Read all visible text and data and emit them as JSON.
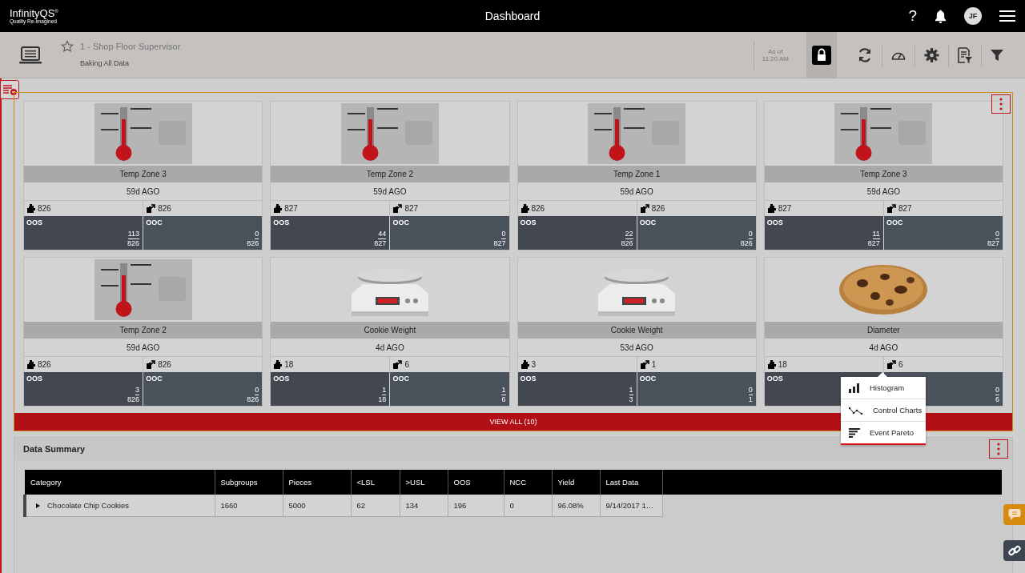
{
  "header": {
    "logo": "InfinityQS",
    "logo_mark": "®",
    "tagline": "Quality Re-imagined",
    "title": "Dashboard",
    "help": "?",
    "avatar": "JF"
  },
  "toolbar": {
    "title": "1 - Shop Floor Supervisor",
    "favorite": false,
    "subtitle": "Baking All Data",
    "as_of": "As of",
    "time": "11:20 AM",
    "locked": true
  },
  "tiles": [
    {
      "kind": "temperature",
      "name": "Temp Zone 3",
      "age": "59d AGO",
      "count_a": "826",
      "count_b": "826",
      "oos_label": "OOS",
      "oos_num": "113",
      "oos_den": "826",
      "ooc_label": "OOC",
      "ooc_num": "0",
      "ooc_den": "826"
    },
    {
      "kind": "temperature",
      "name": "Temp Zone 2",
      "age": "59d AGO",
      "count_a": "827",
      "count_b": "827",
      "oos_label": "OOS",
      "oos_num": "44",
      "oos_den": "827",
      "ooc_label": "OOC",
      "ooc_num": "0",
      "ooc_den": "827"
    },
    {
      "kind": "temperature",
      "name": "Temp Zone 1",
      "age": "59d AGO",
      "count_a": "826",
      "count_b": "826",
      "oos_label": "OOS",
      "oos_num": "22",
      "oos_den": "826",
      "ooc_label": "OOC",
      "ooc_num": "0",
      "ooc_den": "826"
    },
    {
      "kind": "temperature",
      "name": "Temp Zone 3",
      "age": "59d AGO",
      "count_a": "827",
      "count_b": "827",
      "oos_label": "OOS",
      "oos_num": "11",
      "oos_den": "827",
      "ooc_label": "OOC",
      "ooc_num": "0",
      "ooc_den": "827"
    },
    {
      "kind": "temperature",
      "name": "Temp Zone 2",
      "age": "59d AGO",
      "count_a": "826",
      "count_b": "826",
      "oos_label": "OOS",
      "oos_num": "3",
      "oos_den": "826",
      "ooc_label": "OOC",
      "ooc_num": "0",
      "ooc_den": "826"
    },
    {
      "kind": "weight",
      "name": "Cookie Weight",
      "age": "4d AGO",
      "count_a": "18",
      "count_b": "6",
      "oos_label": "OOS",
      "oos_num": "1",
      "oos_den": "18",
      "ooc_label": "OOC",
      "ooc_num": "1",
      "ooc_den": "6"
    },
    {
      "kind": "weight",
      "name": "Cookie Weight",
      "age": "53d AGO",
      "count_a": "3",
      "count_b": "1",
      "oos_label": "OOS",
      "oos_num": "1",
      "oos_den": "3",
      "ooc_label": "OOC",
      "ooc_num": "0",
      "ooc_den": "1"
    },
    {
      "kind": "diameter",
      "name": "Diameter",
      "age": "4d AGO",
      "count_a": "18",
      "count_b": "6",
      "oos_label": "OOS",
      "ooc_num": "0",
      "ooc_den": "6"
    }
  ],
  "view_all": "VIEW ALL (10)",
  "menu": [
    {
      "kind": "histogram",
      "label": "Histogram"
    },
    {
      "kind": "control",
      "label": "Control Charts"
    },
    {
      "kind": "pareto",
      "label": "Event Pareto"
    }
  ],
  "data_summary": {
    "title": "Data Summary",
    "columns": [
      "Category",
      "Subgroups",
      "Pieces",
      "<LSL",
      ">USL",
      "OOS",
      "NCC",
      "Yield",
      "Last Data"
    ],
    "rows": [
      {
        "expanded": false,
        "cells": [
          "Chocolate Chip Cookies",
          "1660",
          "5000",
          "62",
          "134",
          "196",
          "0",
          "96.08%",
          "9/14/2017 1…"
        ]
      }
    ]
  }
}
